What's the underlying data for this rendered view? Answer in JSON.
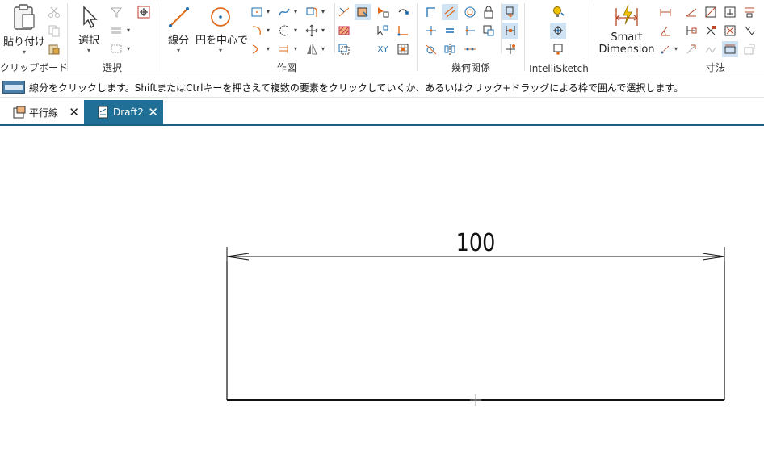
{
  "ribbon": {
    "clipboard": {
      "paste_label": "貼り付け",
      "group_label": "クリップボード"
    },
    "select": {
      "select_label": "選択",
      "group_label": "選択"
    },
    "draw": {
      "line_label": "線分",
      "circle_label": "円を中心で",
      "xy_label": "XY",
      "group_label": "作図"
    },
    "relations": {
      "group_label": "幾何関係"
    },
    "intellisketch": {
      "group_label": "IntelliSketch"
    },
    "dimension": {
      "smart_line1": "Smart",
      "smart_line2": "Dimension",
      "group_label": "寸法"
    }
  },
  "status": {
    "message": "線分をクリックします。ShiftまたはCtrlキーを押さえて複数の要素をクリックしていくか、あるいはクリック+ドラッグによる枠で囲んで選択します。"
  },
  "tabs": [
    {
      "label": "平行線",
      "close": "✕",
      "active": false
    },
    {
      "label": "Draft2",
      "close": "✕",
      "active": true
    }
  ],
  "drawing": {
    "dimension_value": "100"
  },
  "colors": {
    "accent": "#1b5f82",
    "active_tab": "#1f6f96",
    "selected_tool": "#cfe3f5"
  }
}
